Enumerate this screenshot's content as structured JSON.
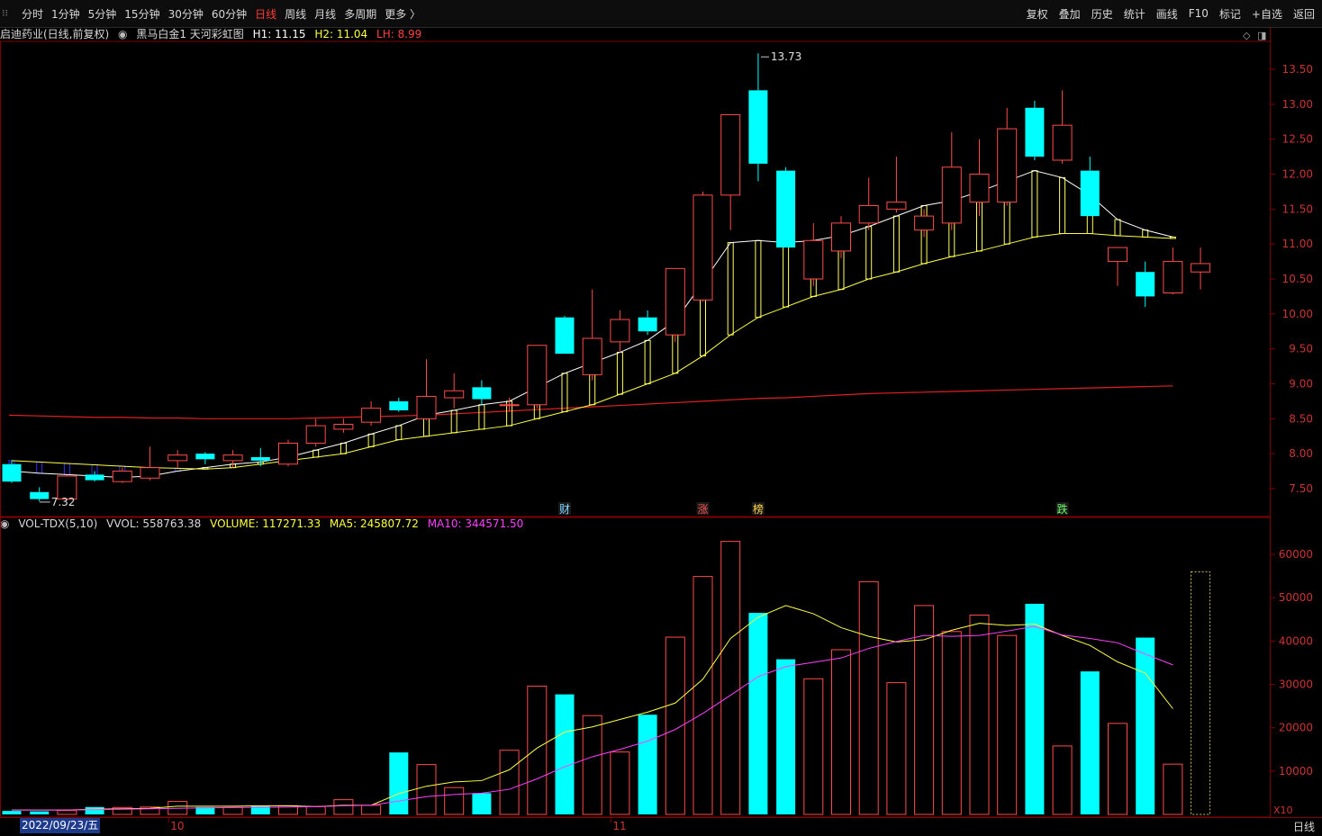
{
  "toolbar": {
    "periods": [
      "分时",
      "1分钟",
      "5分钟",
      "15分钟",
      "30分钟",
      "60分钟",
      "日线",
      "周线",
      "月线",
      "多周期",
      "更多 〉"
    ],
    "active_period": "日线",
    "tools": [
      "复权",
      "叠加",
      "历史",
      "统计",
      "画线",
      "F10",
      "标记",
      "+自选",
      "返回"
    ]
  },
  "info": {
    "stock": "启迪药业(日线,前复权)",
    "indicator": "黑马白金1  天河彩虹图",
    "h1": "H1: 11.15",
    "h2": "H2: 11.04",
    "lh": "LH: 8.99"
  },
  "vol_info": {
    "name": "VOL-TDX(5,10)",
    "vvol": "VVOL: 558763.38",
    "volume": "VOLUME: 117271.33",
    "ma5": "MA5: 245807.72",
    "ma10": "MA10: 344571.50"
  },
  "bottom": {
    "date_label": "2022/09/23/五",
    "month_labels": [
      {
        "i": 6,
        "t": "10"
      },
      {
        "i": 22,
        "t": "11"
      }
    ],
    "tab": "日线",
    "scale_tag": "X10"
  },
  "annotations": {
    "high": "13.73",
    "low": "7.32",
    "markers": [
      {
        "i": 20,
        "t": "财",
        "color": "#7fd6ff"
      },
      {
        "i": 25,
        "t": "涨",
        "color": "#ff5050"
      },
      {
        "i": 27,
        "t": "榜",
        "color": "#ffd24d"
      },
      {
        "i": 38,
        "t": "跌",
        "color": "#6cff6c"
      }
    ]
  },
  "colors": {
    "up": "#ff4a4a",
    "down": "#00ffff",
    "ma5": "#ffff40",
    "ma10": "#ff40ff",
    "grid": "#800000"
  },
  "chart_data": {
    "type": "candlestick",
    "price_axis": {
      "ticks": [
        7.5,
        8.0,
        8.5,
        9.0,
        9.5,
        10.0,
        10.5,
        11.0,
        11.5,
        12.0,
        12.5,
        13.0,
        13.5
      ],
      "ylim": [
        7.1,
        13.9
      ]
    },
    "volume_axis": {
      "ticks": [
        10000,
        20000,
        30000,
        40000,
        50000,
        60000
      ],
      "ylim": [
        0,
        65000
      ]
    },
    "candles": [
      {
        "o": 7.85,
        "h": 7.9,
        "l": 7.58,
        "c": 7.6
      },
      {
        "o": 7.45,
        "h": 7.52,
        "l": 7.32,
        "c": 7.35
      },
      {
        "o": 7.35,
        "h": 7.7,
        "l": 7.33,
        "c": 7.68
      },
      {
        "o": 7.7,
        "h": 7.75,
        "l": 7.6,
        "c": 7.62
      },
      {
        "o": 7.6,
        "h": 7.8,
        "l": 7.58,
        "c": 7.75
      },
      {
        "o": 7.65,
        "h": 8.1,
        "l": 7.62,
        "c": 7.8
      },
      {
        "o": 7.9,
        "h": 8.05,
        "l": 7.8,
        "c": 7.98
      },
      {
        "o": 8.0,
        "h": 8.02,
        "l": 7.85,
        "c": 7.92
      },
      {
        "o": 7.9,
        "h": 8.05,
        "l": 7.8,
        "c": 7.98
      },
      {
        "o": 7.95,
        "h": 8.08,
        "l": 7.82,
        "c": 7.9
      },
      {
        "o": 7.85,
        "h": 8.2,
        "l": 7.82,
        "c": 8.15
      },
      {
        "o": 8.15,
        "h": 8.5,
        "l": 8.1,
        "c": 8.4
      },
      {
        "o": 8.35,
        "h": 8.5,
        "l": 8.3,
        "c": 8.42
      },
      {
        "o": 8.45,
        "h": 8.75,
        "l": 8.4,
        "c": 8.65
      },
      {
        "o": 8.75,
        "h": 8.8,
        "l": 8.6,
        "c": 8.62
      },
      {
        "o": 8.5,
        "h": 9.35,
        "l": 8.48,
        "c": 8.82
      },
      {
        "o": 8.8,
        "h": 9.15,
        "l": 8.65,
        "c": 8.9
      },
      {
        "o": 8.95,
        "h": 9.05,
        "l": 8.7,
        "c": 8.78
      },
      {
        "o": 8.7,
        "h": 8.8,
        "l": 8.6,
        "c": 8.7
      },
      {
        "o": 8.7,
        "h": 9.55,
        "l": 8.65,
        "c": 9.55
      },
      {
        "o": 9.95,
        "h": 9.97,
        "l": 9.43,
        "c": 9.43
      },
      {
        "o": 9.13,
        "h": 10.35,
        "l": 9.05,
        "c": 9.65
      },
      {
        "o": 9.6,
        "h": 10.05,
        "l": 9.45,
        "c": 9.92
      },
      {
        "o": 9.95,
        "h": 10.05,
        "l": 9.7,
        "c": 9.75
      },
      {
        "o": 9.7,
        "h": 10.65,
        "l": 9.6,
        "c": 10.65
      },
      {
        "o": 10.2,
        "h": 11.75,
        "l": 10.18,
        "c": 11.7
      },
      {
        "o": 11.7,
        "h": 12.85,
        "l": 11.2,
        "c": 12.85
      },
      {
        "o": 13.2,
        "h": 13.73,
        "l": 11.9,
        "c": 12.15
      },
      {
        "o": 12.05,
        "h": 12.1,
        "l": 10.95,
        "c": 10.95
      },
      {
        "o": 10.5,
        "h": 11.3,
        "l": 10.4,
        "c": 11.05
      },
      {
        "o": 10.9,
        "h": 11.4,
        "l": 10.8,
        "c": 11.3
      },
      {
        "o": 11.3,
        "h": 11.95,
        "l": 11.2,
        "c": 11.55
      },
      {
        "o": 11.5,
        "h": 12.25,
        "l": 11.45,
        "c": 11.6
      },
      {
        "o": 11.2,
        "h": 11.5,
        "l": 11.1,
        "c": 11.4
      },
      {
        "o": 11.3,
        "h": 12.6,
        "l": 11.2,
        "c": 12.1
      },
      {
        "o": 11.6,
        "h": 12.5,
        "l": 11.4,
        "c": 12.0
      },
      {
        "o": 11.6,
        "h": 12.95,
        "l": 11.55,
        "c": 12.65
      },
      {
        "o": 12.95,
        "h": 13.05,
        "l": 12.2,
        "c": 12.25
      },
      {
        "o": 12.2,
        "h": 13.2,
        "l": 12.15,
        "c": 12.7
      },
      {
        "o": 12.05,
        "h": 12.25,
        "l": 11.4,
        "c": 11.4
      },
      {
        "o": 10.75,
        "h": 10.95,
        "l": 10.4,
        "c": 10.95
      },
      {
        "o": 10.6,
        "h": 10.75,
        "l": 10.1,
        "c": 10.25
      },
      {
        "o": 10.3,
        "h": 10.95,
        "l": 10.28,
        "c": 10.75
      },
      {
        "o": 10.6,
        "h": 10.95,
        "l": 10.35,
        "c": 10.72
      }
    ],
    "volume": [
      0.8,
      0.7,
      0.9,
      1.7,
      1.6,
      1.7,
      3.0,
      1.7,
      1.6,
      1.9,
      2.0,
      1.8,
      3.4,
      2.1,
      14.3,
      11.5,
      6.2,
      4.9,
      14.8,
      29.6,
      27.7,
      22.8,
      14.4,
      23.0,
      40.9,
      54.9,
      63.0,
      46.5,
      35.8,
      31.3,
      38.0,
      53.7,
      30.4,
      48.2,
      42.2,
      46.0,
      41.3,
      48.6,
      15.8,
      33.0,
      21.0,
      40.8,
      11.6
    ],
    "vol_ma5": [
      1.0,
      1.0,
      1.0,
      1.2,
      1.3,
      1.4,
      1.9,
      1.9,
      1.9,
      2.0,
      2.0,
      1.8,
      2.1,
      2.1,
      4.8,
      6.5,
      7.5,
      7.8,
      10.3,
      15.3,
      19.0,
      20.2,
      21.9,
      23.6,
      25.7,
      31.2,
      40.6,
      45.5,
      48.2,
      46.3,
      43.1,
      41.1,
      39.8,
      40.3,
      42.5,
      44.1,
      43.6,
      43.9,
      41.3,
      39.0,
      35.2,
      32.6,
      24.4
    ],
    "vol_ma10": [
      1.0,
      1.0,
      1.0,
      1.1,
      1.2,
      1.3,
      1.4,
      1.5,
      1.6,
      1.6,
      1.7,
      1.8,
      2.0,
      2.1,
      3.1,
      4.1,
      4.6,
      4.9,
      5.8,
      8.2,
      11.0,
      13.3,
      15.0,
      16.9,
      19.6,
      23.3,
      27.5,
      31.8,
      34.1,
      35.1,
      36.1,
      38.3,
      39.9,
      41.3,
      41.1,
      41.3,
      42.3,
      43.4,
      41.4,
      40.6,
      39.6,
      37.0,
      34.5
    ],
    "ribbon_fast": [
      7.75,
      7.72,
      7.7,
      7.68,
      7.66,
      7.68,
      7.75,
      7.8,
      7.85,
      7.88,
      7.95,
      8.05,
      8.15,
      8.28,
      8.4,
      8.55,
      8.62,
      8.7,
      8.75,
      8.95,
      9.15,
      9.3,
      9.45,
      9.62,
      9.9,
      10.45,
      11.02,
      11.05,
      11.02,
      11.05,
      11.12,
      11.25,
      11.4,
      11.55,
      11.62,
      11.75,
      11.9,
      12.05,
      11.95,
      11.7,
      11.35,
      11.2,
      11.1
    ],
    "ribbon_slow": [
      7.9,
      7.88,
      7.86,
      7.84,
      7.82,
      7.8,
      7.79,
      7.78,
      7.8,
      7.85,
      7.9,
      7.95,
      8.0,
      8.1,
      8.2,
      8.25,
      8.3,
      8.35,
      8.4,
      8.5,
      8.6,
      8.7,
      8.85,
      9.0,
      9.15,
      9.4,
      9.7,
      9.95,
      10.1,
      10.25,
      10.35,
      10.5,
      10.6,
      10.72,
      10.82,
      10.9,
      11.0,
      11.1,
      11.15,
      11.15,
      11.12,
      11.1,
      11.08
    ],
    "ma_red": [
      8.55,
      8.54,
      8.53,
      8.52,
      8.52,
      8.51,
      8.51,
      8.5,
      8.5,
      8.5,
      8.5,
      8.51,
      8.52,
      8.53,
      8.54,
      8.55,
      8.57,
      8.59,
      8.61,
      8.63,
      8.65,
      8.67,
      8.69,
      8.71,
      8.73,
      8.75,
      8.77,
      8.79,
      8.8,
      8.82,
      8.84,
      8.86,
      8.87,
      8.88,
      8.89,
      8.9,
      8.91,
      8.92,
      8.93,
      8.94,
      8.95,
      8.96,
      8.97
    ]
  }
}
